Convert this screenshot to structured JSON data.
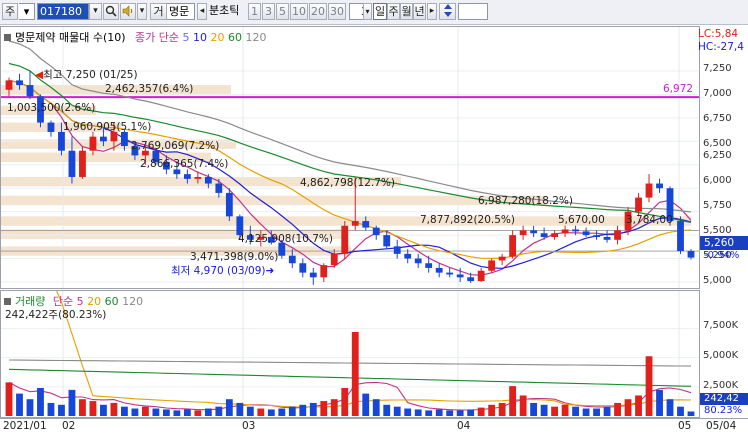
{
  "toolbar": {
    "market_btn": "주",
    "code": "017180",
    "search_icon": "magnifier-icon",
    "sound_icon": "speaker-icon",
    "name_btn": "거",
    "stock_name": "명문",
    "period_unit": "분초틱",
    "periods": [
      "1",
      "3",
      "5",
      "10",
      "20",
      "30"
    ],
    "interval_value": "3",
    "interval_unit": "일",
    "unit_week": "주",
    "unit_month": "월",
    "unit_year": "년"
  },
  "price_pane": {
    "title": "명문제약 매물대 수(10)",
    "ma_label": "종가 단순",
    "ma_periods": [
      "5",
      "10",
      "20",
      "60",
      "120"
    ],
    "ma_colors": [
      "#6a6aff",
      "#1e1ed6",
      "#e6a100",
      "#1c8a2e",
      "#8a8a8a"
    ],
    "lc_label": "LC:5,84",
    "hc_label": "HC:-27,4",
    "current_price": "5,260",
    "change": "-0.94%",
    "hline_value": "6,972",
    "high_label": "최고 7,250 (01/25)",
    "low_label": "최저 4,970 (03/09)",
    "volume_profile": [
      "2,462,357(6.4%)",
      "1,003,500(2.6%)",
      "1,960,905(5.1%)",
      "2,769,069(7.2%)",
      "2,866,365(7.4%)",
      "4,862,798(12.7%)",
      "6,987,280(18.2%)",
      "7,877,892(20.5%)",
      "4,125,908(10.7%)",
      "3,471,398(9.0%)"
    ],
    "right_label_a": "5,670,00",
    "right_label_b": "3,784,00"
  },
  "volume_pane": {
    "title": "거래량",
    "ma_label": "단순",
    "ma_periods": [
      "5",
      "20",
      "60",
      "120"
    ],
    "ma_colors": [
      "#c0338b",
      "#e6a100",
      "#1c8a2e",
      "#8a8a8a"
    ],
    "value_label": "242,422주(80.23%)",
    "current_volume": "242,42",
    "ratio": "80.23%"
  },
  "x_axis": [
    "2021/01",
    "02",
    "03",
    "04",
    "05",
    "05/04"
  ],
  "chart_data": {
    "type": "candlestick",
    "price_ticks": [
      "7,250",
      "7,000",
      "6,750",
      "6,500",
      "6,250",
      "6,000",
      "5,750",
      "5,500",
      "5,250",
      "5,000"
    ],
    "volume_ticks": [
      "7,500K",
      "5,000K",
      "2,500K"
    ],
    "ohlc": [
      [
        7050,
        7180,
        6980,
        7150
      ],
      [
        7150,
        7220,
        7050,
        7100
      ],
      [
        7100,
        7250,
        6950,
        6980
      ],
      [
        6980,
        7000,
        6650,
        6700
      ],
      [
        6700,
        6720,
        6550,
        6600
      ],
      [
        6600,
        6700,
        6350,
        6400
      ],
      [
        6400,
        6550,
        6050,
        6120
      ],
      [
        6120,
        6450,
        6100,
        6400
      ],
      [
        6400,
        6600,
        6350,
        6550
      ],
      [
        6550,
        6650,
        6450,
        6500
      ],
      [
        6500,
        6700,
        6400,
        6600
      ],
      [
        6600,
        6620,
        6400,
        6450
      ],
      [
        6450,
        6500,
        6300,
        6350
      ],
      [
        6350,
        6450,
        6250,
        6400
      ],
      [
        6400,
        6420,
        6250,
        6280
      ],
      [
        6280,
        6350,
        6150,
        6200
      ],
      [
        6200,
        6280,
        6100,
        6150
      ],
      [
        6150,
        6200,
        6050,
        6100
      ],
      [
        6100,
        6180,
        6050,
        6120
      ],
      [
        6120,
        6150,
        6000,
        6050
      ],
      [
        6050,
        6100,
        5900,
        5950
      ],
      [
        5950,
        6000,
        5650,
        5700
      ],
      [
        5700,
        5720,
        5450,
        5500
      ],
      [
        5500,
        5600,
        5400,
        5450
      ],
      [
        5450,
        5550,
        5380,
        5480
      ],
      [
        5480,
        5550,
        5400,
        5420
      ],
      [
        5420,
        5450,
        5250,
        5280
      ],
      [
        5280,
        5350,
        5150,
        5200
      ],
      [
        5200,
        5250,
        5050,
        5100
      ],
      [
        5100,
        5150,
        4970,
        5050
      ],
      [
        5050,
        5200,
        5000,
        5180
      ],
      [
        5180,
        5350,
        5150,
        5300
      ],
      [
        5300,
        5650,
        5250,
        5600
      ],
      [
        5600,
        6120,
        5550,
        5650
      ],
      [
        5650,
        5700,
        5550,
        5580
      ],
      [
        5580,
        5600,
        5450,
        5500
      ],
      [
        5500,
        5550,
        5350,
        5380
      ],
      [
        5380,
        5450,
        5250,
        5300
      ],
      [
        5300,
        5350,
        5200,
        5250
      ],
      [
        5250,
        5300,
        5150,
        5200
      ],
      [
        5200,
        5280,
        5100,
        5150
      ],
      [
        5150,
        5200,
        5050,
        5100
      ],
      [
        5100,
        5150,
        5050,
        5080
      ],
      [
        5080,
        5150,
        5000,
        5050
      ],
      [
        5050,
        5100,
        4990,
        5010
      ],
      [
        5010,
        5150,
        5000,
        5120
      ],
      [
        5120,
        5250,
        5100,
        5230
      ],
      [
        5230,
        5300,
        5180,
        5270
      ],
      [
        5270,
        5550,
        5250,
        5500
      ],
      [
        5500,
        5600,
        5450,
        5550
      ],
      [
        5550,
        5600,
        5480,
        5520
      ],
      [
        5520,
        5580,
        5450,
        5480
      ],
      [
        5480,
        5550,
        5450,
        5520
      ],
      [
        5520,
        5600,
        5480,
        5560
      ],
      [
        5560,
        5600,
        5500,
        5540
      ],
      [
        5540,
        5580,
        5480,
        5500
      ],
      [
        5500,
        5550,
        5450,
        5480
      ],
      [
        5480,
        5550,
        5420,
        5450
      ],
      [
        5450,
        5600,
        5400,
        5550
      ],
      [
        5550,
        5800,
        5500,
        5750
      ],
      [
        5750,
        5950,
        5700,
        5900
      ],
      [
        5900,
        6150,
        5850,
        6050
      ],
      [
        6050,
        6100,
        5950,
        6000
      ],
      [
        6000,
        6020,
        5600,
        5650
      ],
      [
        5650,
        5700,
        5300,
        5330
      ],
      [
        5330,
        5350,
        5240,
        5260
      ]
    ],
    "volume": [
      1800,
      1200,
      900,
      1500,
      700,
      600,
      1400,
      900,
      800,
      600,
      700,
      500,
      400,
      500,
      400,
      350,
      300,
      350,
      300,
      400,
      500,
      900,
      700,
      500,
      400,
      350,
      400,
      500,
      600,
      700,
      800,
      900,
      1500,
      4500,
      1200,
      900,
      600,
      500,
      400,
      350,
      300,
      350,
      300,
      300,
      350,
      450,
      600,
      700,
      1600,
      1100,
      700,
      600,
      500,
      600,
      500,
      400,
      400,
      500,
      700,
      900,
      1100,
      3200,
      1400,
      900,
      500,
      242
    ]
  }
}
